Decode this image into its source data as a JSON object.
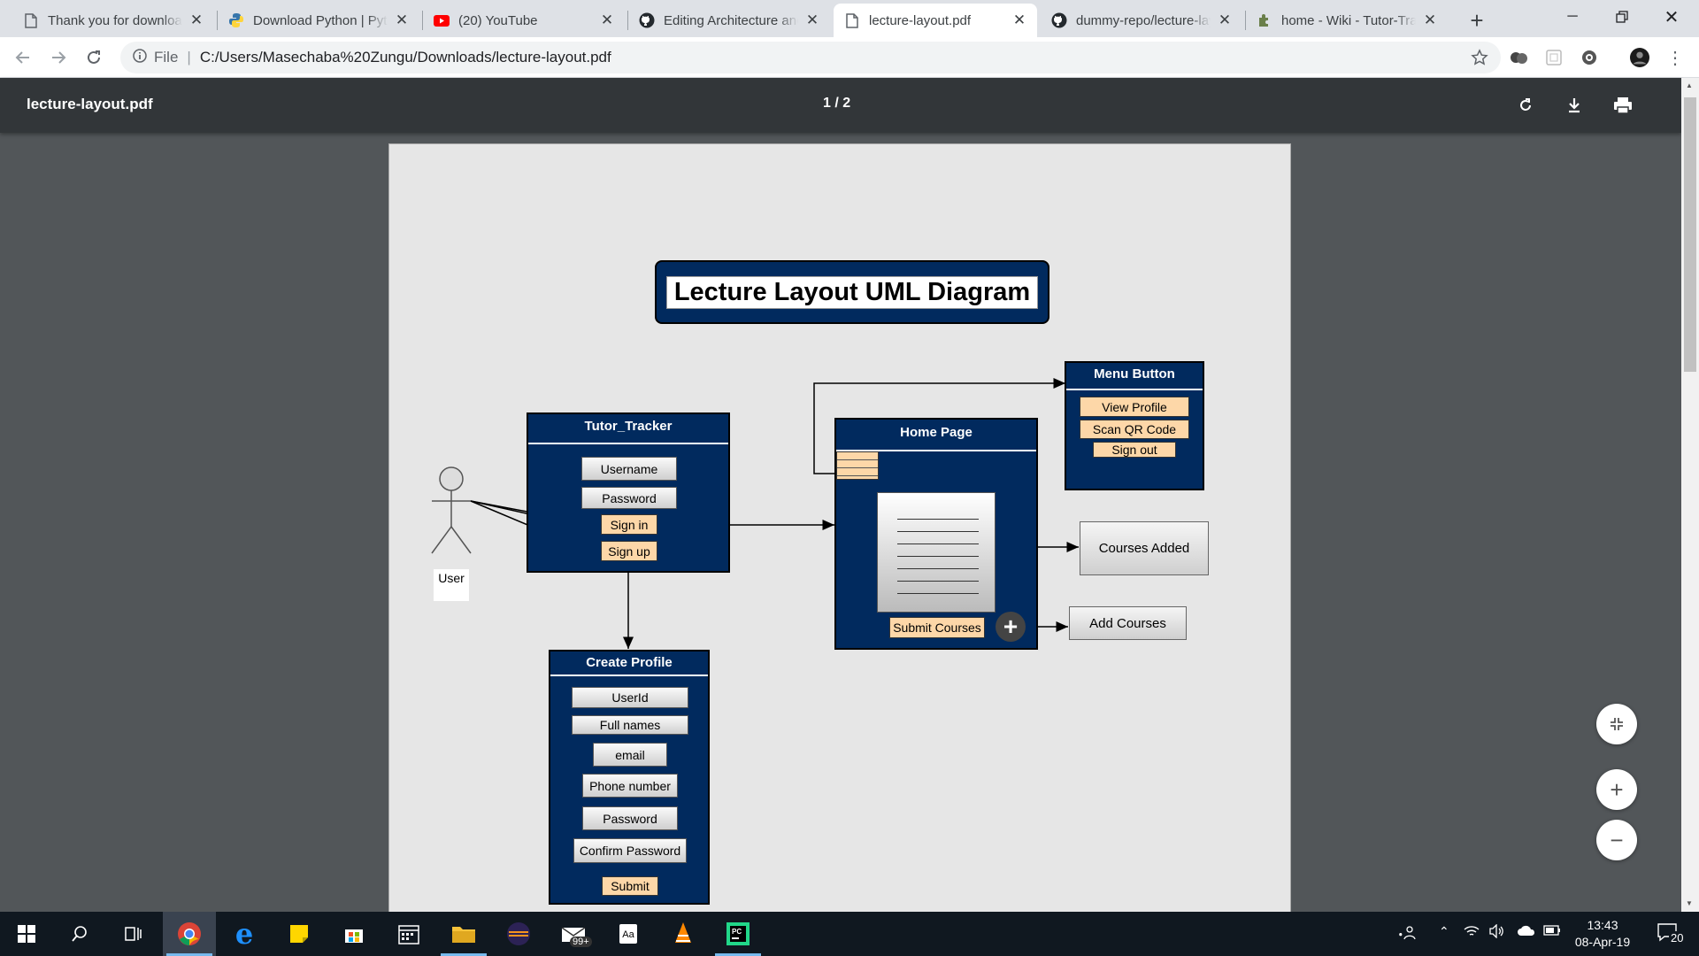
{
  "browser": {
    "tabs": [
      {
        "label": "Thank you for downloading",
        "icon": "document-icon"
      },
      {
        "label": "Download Python | Python.org",
        "icon": "python-icon"
      },
      {
        "label": "(20) YouTube",
        "icon": "youtube-icon"
      },
      {
        "label": "Editing Architecture and Design",
        "icon": "github-icon"
      },
      {
        "label": "lecture-layout.pdf",
        "icon": "document-icon",
        "active": true
      },
      {
        "label": "dummy-repo/lecture-layout",
        "icon": "github-icon"
      },
      {
        "label": "home - Wiki - Tutor-Tracker",
        "icon": "puzzle-icon"
      }
    ],
    "new_tab": "+",
    "address": {
      "scheme_label": "File",
      "url": "C:/Users/Masechaba%20Zungu/Downloads/lecture-layout.pdf"
    }
  },
  "pdf": {
    "title": "lecture-layout.pdf",
    "page_indicator": "1 / 2"
  },
  "diagram": {
    "title": "Lecture Layout UML Diagram",
    "actor": "User",
    "tutor_tracker": {
      "title": "Tutor_Tracker",
      "fields": [
        "Username",
        "Password"
      ],
      "actions": [
        "Sign in",
        "Sign up"
      ]
    },
    "home_page": {
      "title": "Home Page",
      "submit": "Submit Courses"
    },
    "menu_button": {
      "title": "Menu Button",
      "items": [
        "View Profile",
        "Scan QR Code",
        "Sign out"
      ]
    },
    "courses_added": "Courses Added",
    "add_courses": "Add Courses",
    "create_profile": {
      "title": "Create Profile",
      "fields": [
        "UserId",
        "Full names",
        "email",
        "Phone number",
        "Password",
        "Confirm Password"
      ],
      "submit": "Submit"
    }
  },
  "taskbar": {
    "mail_badge": "99+",
    "time": "13:43",
    "date": "08-Apr-19",
    "notifications": "20"
  },
  "colors": {
    "diagram_navy": "#012a5e",
    "button_orange": "#fdd7a8",
    "pdf_toolbar": "#323639"
  }
}
